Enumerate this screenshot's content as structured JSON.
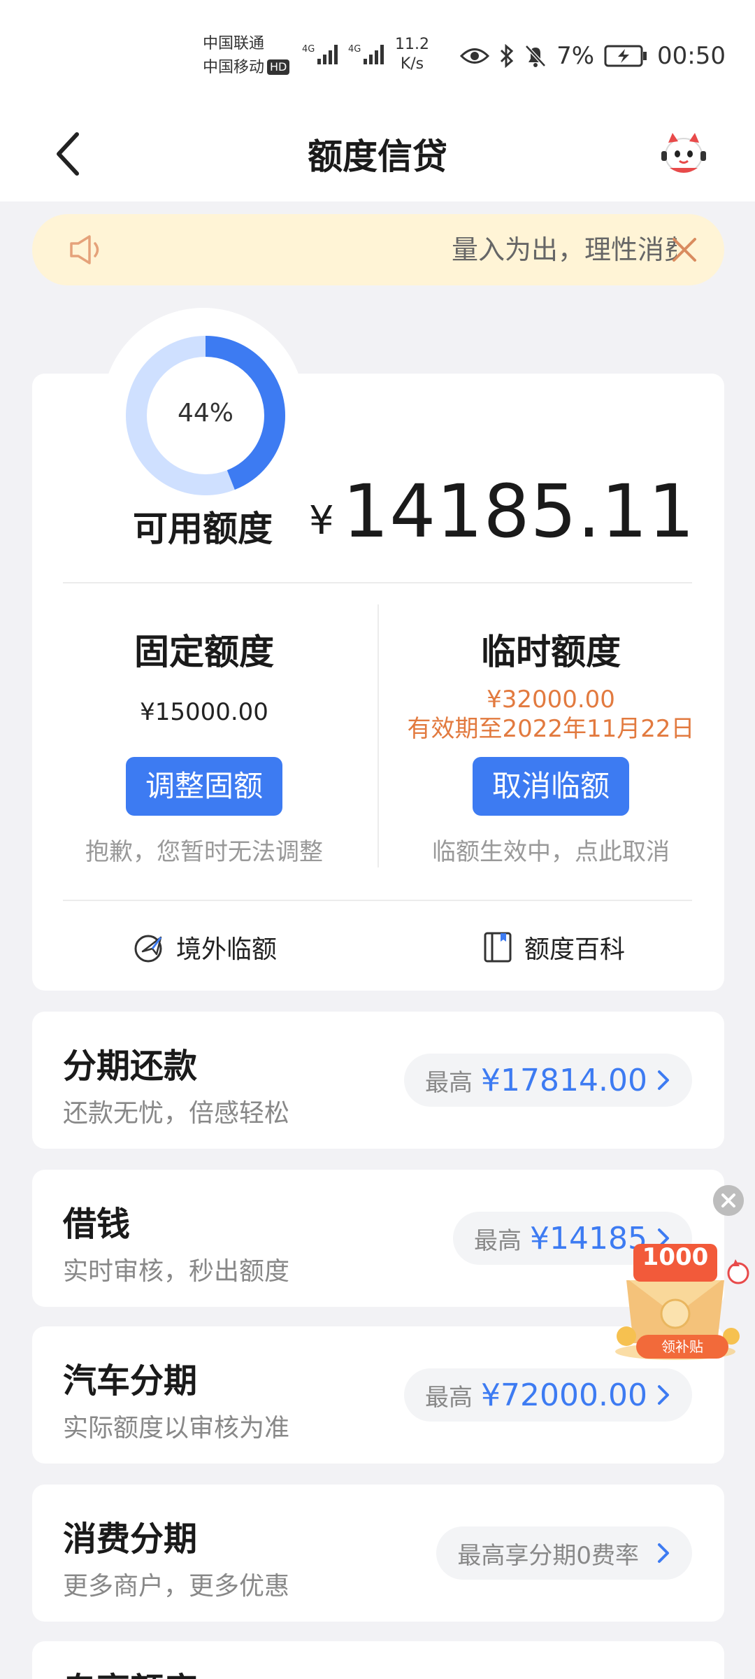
{
  "status_bar": {
    "carrier_1": "中国联通",
    "carrier_2": "中国移动",
    "hd_badge": "HD",
    "net_type_1": "4G",
    "net_type_2": "4G",
    "net_speed_value": "11.2",
    "net_speed_unit": "K/s",
    "battery": "7%",
    "time": "00:50"
  },
  "header": {
    "title": "额度信贷"
  },
  "notice": {
    "text": "量入为出，理性消费"
  },
  "credit": {
    "ring_percent_label": "44%",
    "ring_fraction": 0.44,
    "available_label": "可用额度",
    "currency_symbol": "¥",
    "available_amount": "14185.11",
    "fixed": {
      "title": "固定额度",
      "amount": "¥15000.00",
      "button": "调整固额",
      "hint": "抱歉，您暂时无法调整"
    },
    "temporary": {
      "title": "临时额度",
      "amount": "¥32000.00",
      "validity": "有效期至2022年11月22日",
      "button": "取消临额",
      "hint": "临额生效中，点此取消"
    },
    "links": {
      "overseas": "境外临额",
      "wiki": "额度百科"
    }
  },
  "services": [
    {
      "title": "分期还款",
      "subtitle": "还款无忧，倍感轻松",
      "pill_prefix": "最高",
      "pill_amount": "¥17814.00"
    },
    {
      "title": "借钱",
      "subtitle": "实时审核，秒出额度",
      "pill_prefix": "最高",
      "pill_amount": "¥14185"
    },
    {
      "title": "汽车分期",
      "subtitle": "实际额度以审核为准",
      "pill_prefix": "最高",
      "pill_amount": "¥72000.00"
    },
    {
      "title": "消费分期",
      "subtitle": "更多商户，更多优惠",
      "pill_prefix": "最高享分期0费率",
      "pill_amount": ""
    }
  ],
  "bottom_peek_title": "专享额度",
  "coupon": {
    "amount": "1000",
    "button": "领补贴"
  },
  "colors": {
    "accent_blue": "#3d7bf2",
    "ring_track": "#cfe0ff",
    "orange": "#e27a3f",
    "notice_bg": "#fff4d6"
  }
}
